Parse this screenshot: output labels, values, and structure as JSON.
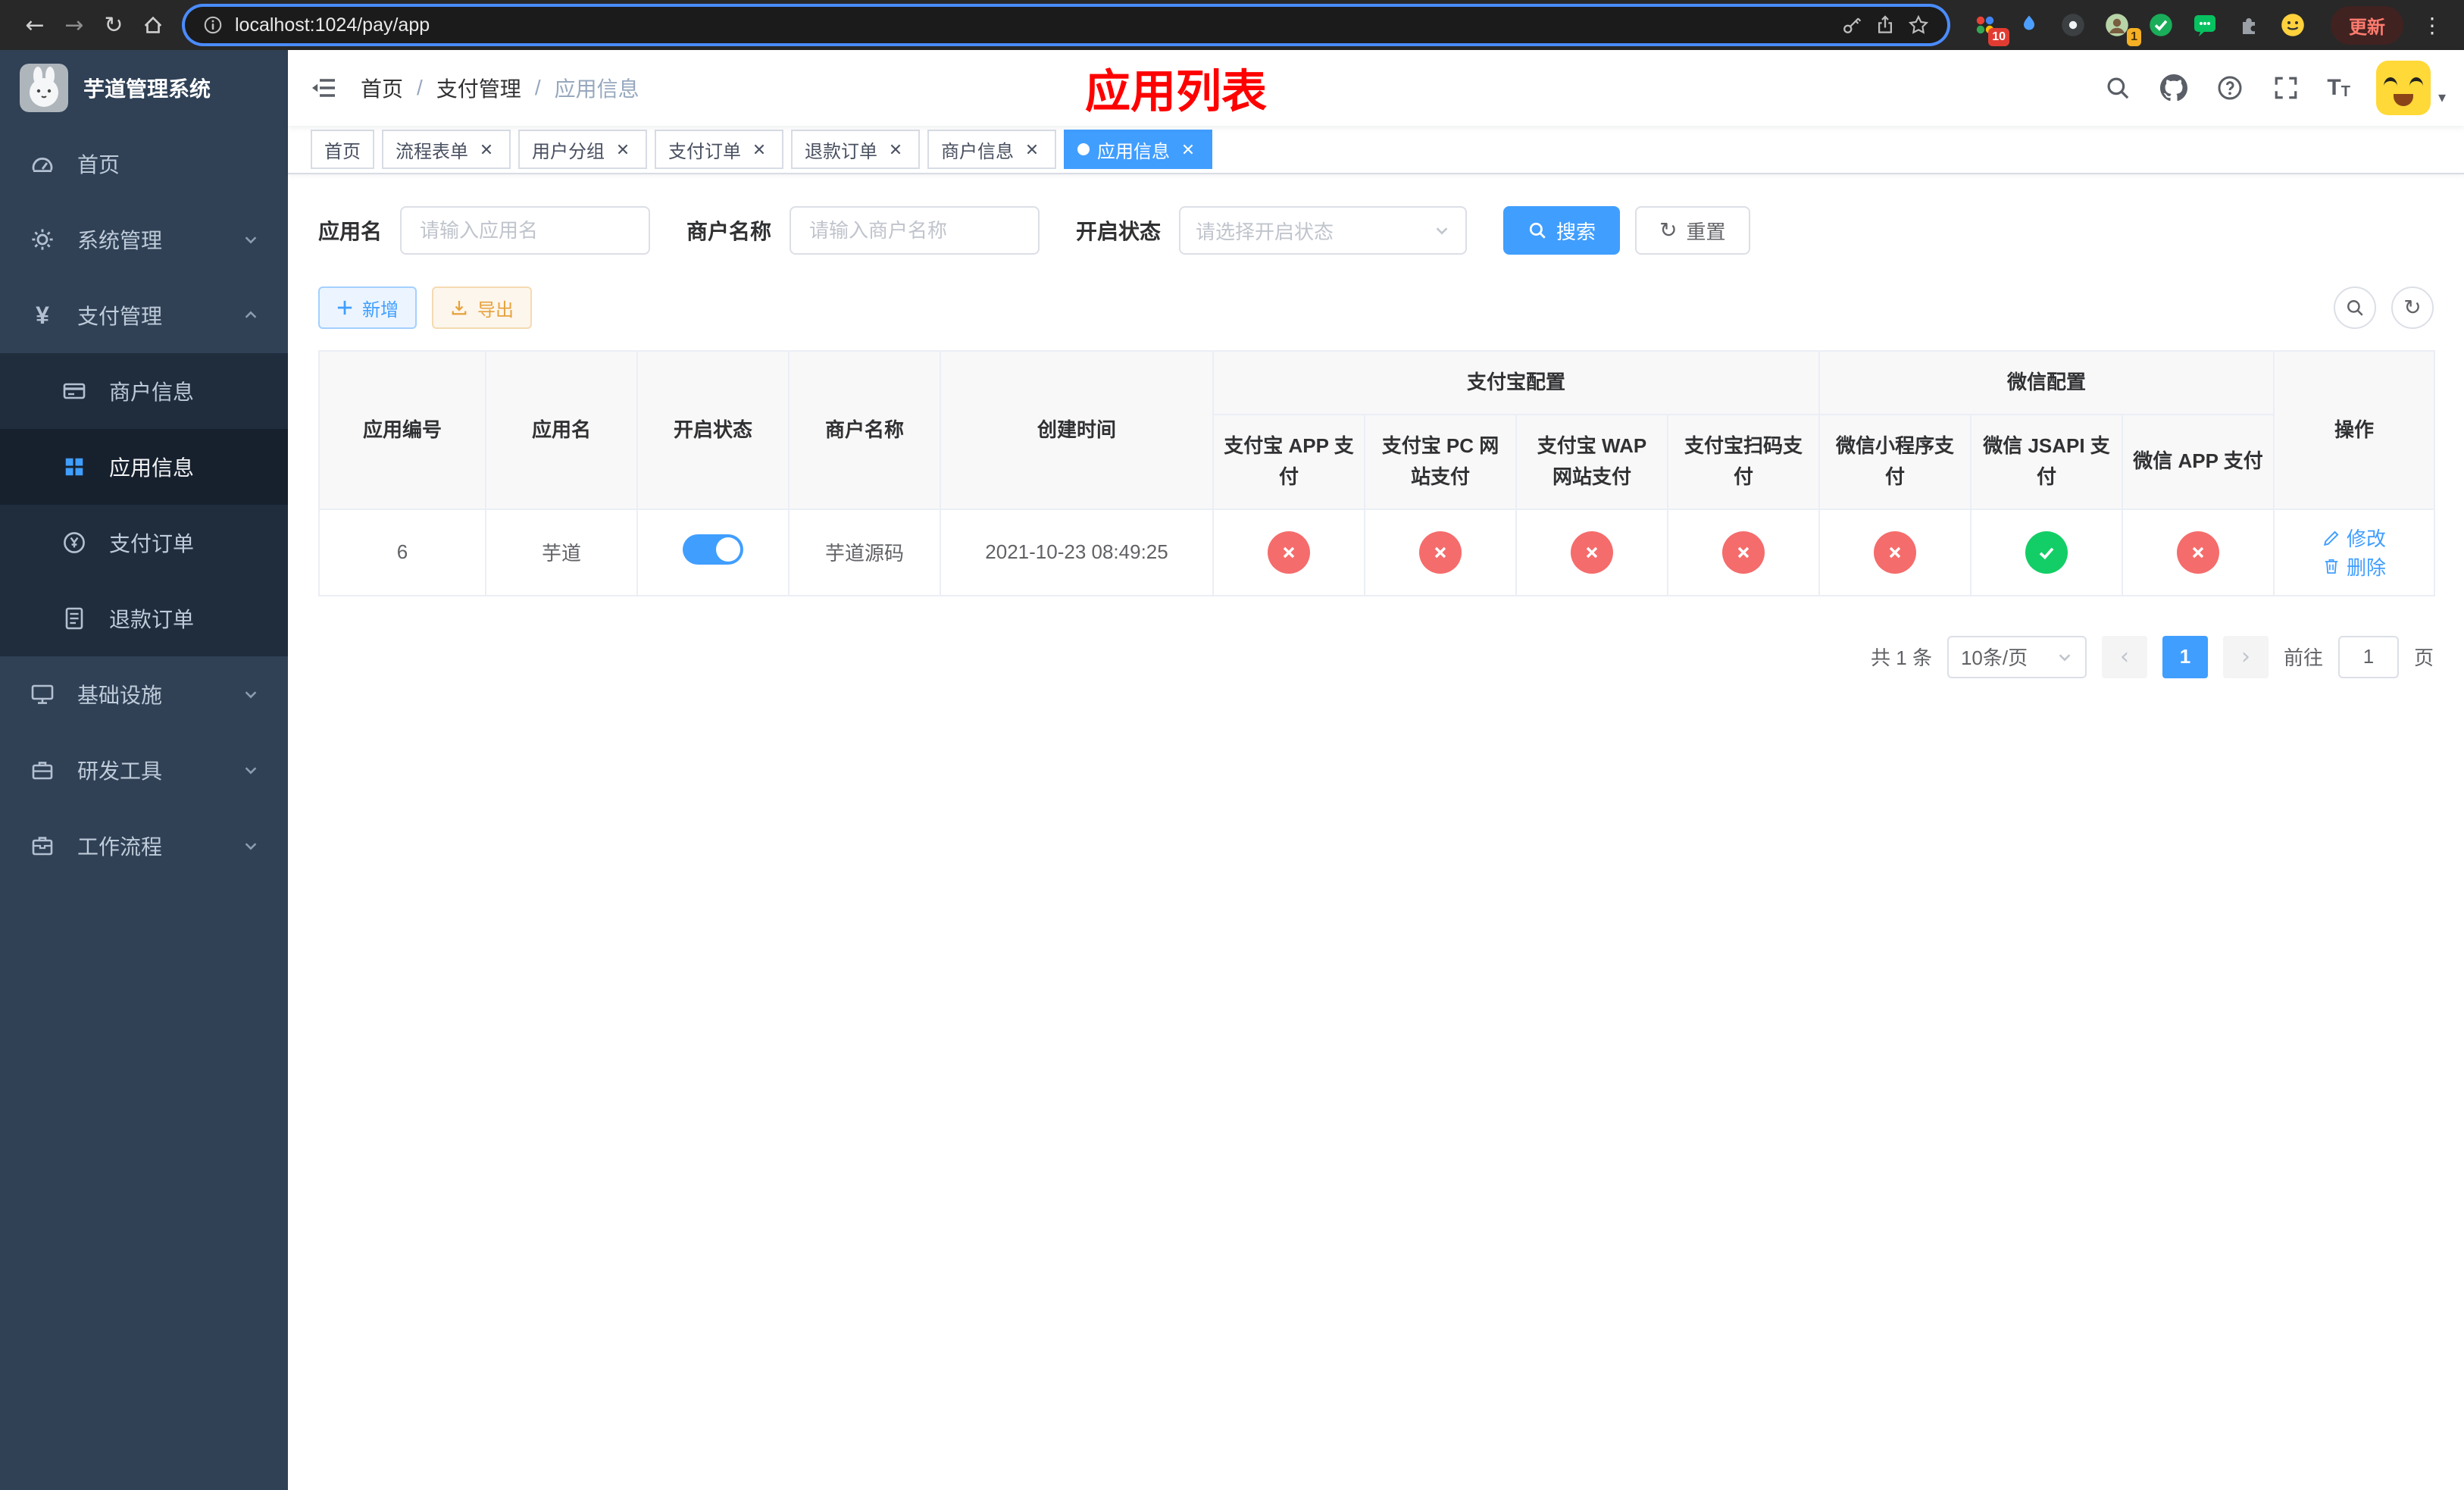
{
  "colors": {
    "accent": "#409eff",
    "success": "#13ce66",
    "danger": "#f56c6c",
    "warning": "#e6a23c",
    "annotation": "#ff0000"
  },
  "browser": {
    "url": "localhost:1024/pay/app",
    "update_button": "更新",
    "extension_badge_grid": "10",
    "extension_badge_avatar": "1"
  },
  "sidebar": {
    "logo_title": "芋道管理系统",
    "menu": [
      {
        "label": "首页"
      },
      {
        "label": "系统管理"
      },
      {
        "label": "支付管理"
      },
      {
        "label": "商户信息"
      },
      {
        "label": "应用信息"
      },
      {
        "label": "支付订单"
      },
      {
        "label": "退款订单"
      },
      {
        "label": "基础设施"
      },
      {
        "label": "研发工具"
      },
      {
        "label": "工作流程"
      }
    ]
  },
  "header": {
    "breadcrumb": [
      {
        "label": "首页"
      },
      {
        "label": "支付管理"
      },
      {
        "label": "应用信息"
      }
    ],
    "separator": "/",
    "annotation_title": "应用列表"
  },
  "tabs": [
    {
      "label": "首页"
    },
    {
      "label": "流程表单"
    },
    {
      "label": "用户分组"
    },
    {
      "label": "支付订单"
    },
    {
      "label": "退款订单"
    },
    {
      "label": "商户信息"
    },
    {
      "label": "应用信息"
    }
  ],
  "filters": {
    "app_name": {
      "label": "应用名",
      "placeholder": "请输入应用名",
      "value": ""
    },
    "merchant_name": {
      "label": "商户名称",
      "placeholder": "请输入商户名称",
      "value": ""
    },
    "status": {
      "label": "开启状态",
      "placeholder": "请选择开启状态"
    },
    "search_button": "搜索",
    "reset_button": "重置"
  },
  "toolbar": {
    "add_button": "新增",
    "export_button": "导出"
  },
  "table": {
    "columns": {
      "app_id": "应用编号",
      "app_name": "应用名",
      "status": "开启状态",
      "merchant_name": "商户名称",
      "created_at": "创建时间",
      "alipay_group": "支付宝配置",
      "wechat_group": "微信配置",
      "alipay_app": "支付宝 APP 支付",
      "alipay_pc": "支付宝 PC 网站支付",
      "alipay_wap": "支付宝 WAP 网站支付",
      "alipay_qr": "支付宝扫码支付",
      "wechat_mini": "微信小程序支付",
      "wechat_jsapi": "微信 JSAPI 支付",
      "wechat_app": "微信 APP 支付",
      "actions": "操作"
    },
    "rows": [
      {
        "app_id": "6",
        "app_name": "芋道",
        "status_on": true,
        "merchant_name": "芋道源码",
        "created_at": "2021-10-23 08:49:25",
        "alipay_app": false,
        "alipay_pc": false,
        "alipay_wap": false,
        "alipay_qr": false,
        "wechat_mini": false,
        "wechat_jsapi": true,
        "wechat_app": false,
        "edit_label": "修改",
        "delete_label": "删除"
      }
    ]
  },
  "pagination": {
    "total": "共 1 条",
    "page_size": "10条/页",
    "current_page": "1",
    "goto_prefix": "前往",
    "goto_value": "1",
    "goto_suffix": "页"
  }
}
